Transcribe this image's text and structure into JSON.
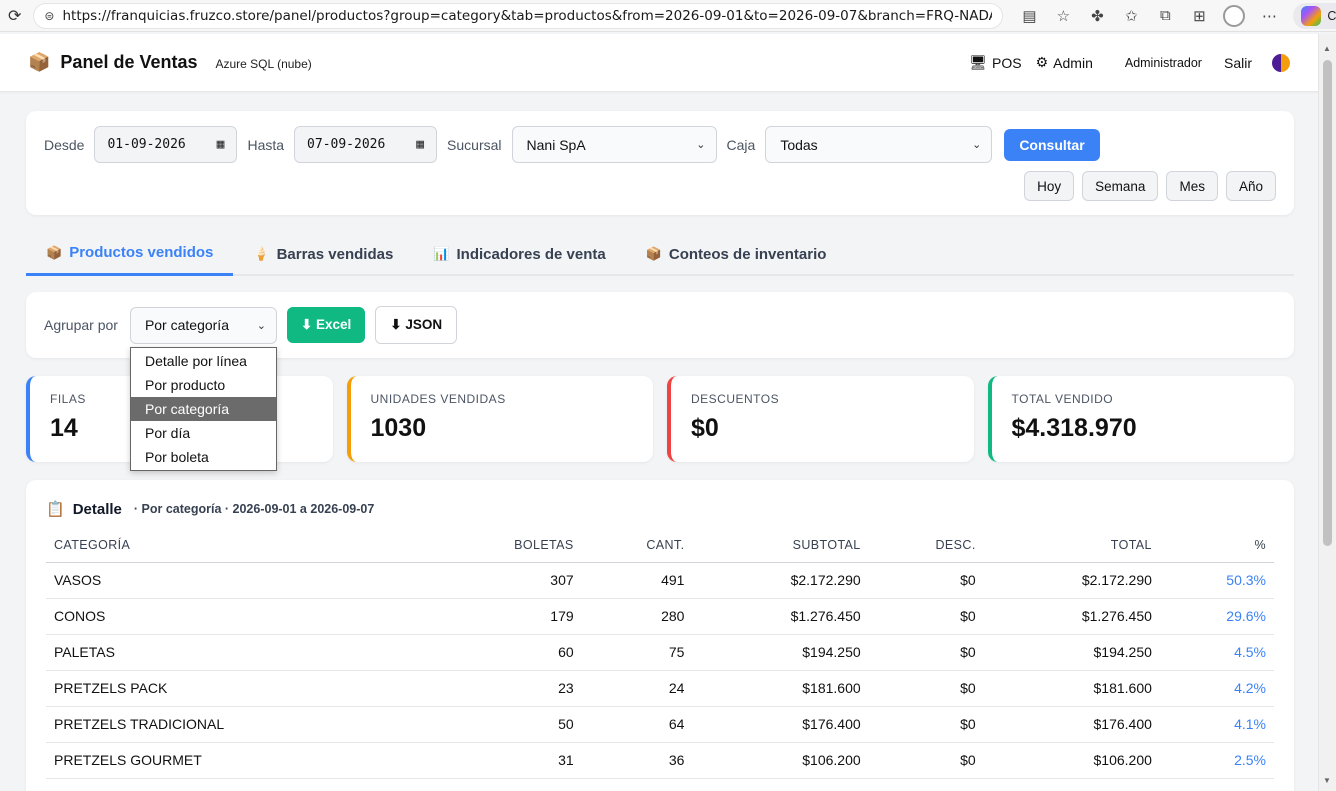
{
  "browser": {
    "url": "https://franquicias.fruzco.store/panel/productos?group=category&tab=productos&from=2026-09-01&to=2026-09-07&branch=FRQ-NADA",
    "chat_label": "Chat"
  },
  "header": {
    "title": "Panel de Ventas",
    "db_label": "Azure SQL (nube)",
    "pos_label": "POS",
    "admin_label": "Admin",
    "user": "Administrador",
    "logout": "Salir"
  },
  "filters": {
    "from_label": "Desde",
    "from_value": "01-09-2026",
    "to_label": "Hasta",
    "to_value": "07-09-2026",
    "branch_label": "Sucursal",
    "branch_value": "Nani SpA",
    "register_label": "Caja",
    "register_value": "Todas",
    "submit": "Consultar",
    "quick": [
      "Hoy",
      "Semana",
      "Mes",
      "Año"
    ]
  },
  "tabs": [
    {
      "label": "Productos vendidos",
      "icon": "package-icon"
    },
    {
      "label": "Barras vendidas",
      "icon": "ice-cream-icon"
    },
    {
      "label": "Indicadores de venta",
      "icon": "bar-chart-icon"
    },
    {
      "label": "Conteos de inventario",
      "icon": "package-icon"
    }
  ],
  "group": {
    "label": "Agrupar por",
    "value": "Por categoría",
    "excel": "⬇ Excel",
    "json": "⬇ JSON",
    "options": [
      "Detalle por línea",
      "Por producto",
      "Por categoría",
      "Por día",
      "Por boleta"
    ]
  },
  "kpis": [
    {
      "label": "FILAS",
      "value": "14",
      "color": "#3b82f6"
    },
    {
      "label": "UNIDADES VENDIDAS",
      "value": "1030",
      "color": "#f59e0b"
    },
    {
      "label": "DESCUENTOS",
      "value": "$0",
      "color": "#ef4444"
    },
    {
      "label": "TOTAL VENDIDO",
      "value": "$4.318.970",
      "color": "#10b981"
    }
  ],
  "detail": {
    "title": "Detalle",
    "subtitle": "· Por categoría · 2026-09-01 a 2026-09-07",
    "columns": [
      "CATEGORÍA",
      "BOLETAS",
      "CANT.",
      "SUBTOTAL",
      "DESC.",
      "TOTAL",
      "%"
    ],
    "rows": [
      [
        "VASOS",
        "307",
        "491",
        "$2.172.290",
        "$0",
        "$2.172.290",
        "50.3%"
      ],
      [
        "CONOS",
        "179",
        "280",
        "$1.276.450",
        "$0",
        "$1.276.450",
        "29.6%"
      ],
      [
        "PALETAS",
        "60",
        "75",
        "$194.250",
        "$0",
        "$194.250",
        "4.5%"
      ],
      [
        "PRETZELS PACK",
        "23",
        "24",
        "$181.600",
        "$0",
        "$181.600",
        "4.2%"
      ],
      [
        "PRETZELS TRADICIONAL",
        "50",
        "64",
        "$176.400",
        "$0",
        "$176.400",
        "4.1%"
      ],
      [
        "PRETZELS GOURMET",
        "31",
        "36",
        "$106.200",
        "$0",
        "$106.200",
        "2.5%"
      ]
    ]
  }
}
